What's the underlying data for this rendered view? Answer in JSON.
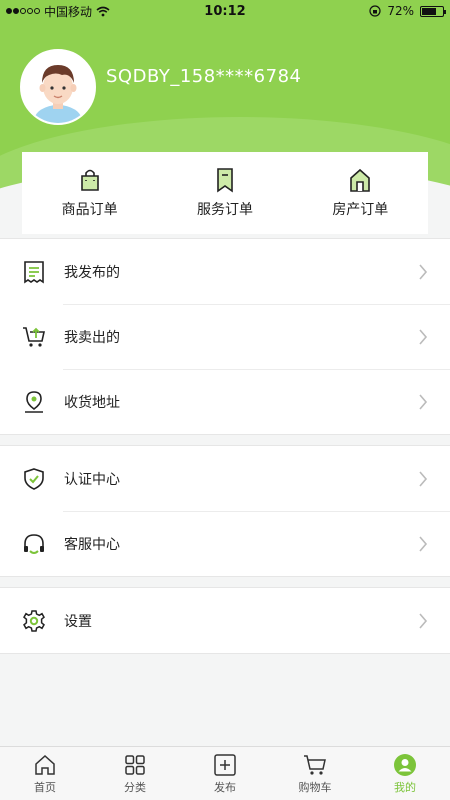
{
  "status": {
    "carrier": "中国移动",
    "time": "10:12",
    "battery": "72%"
  },
  "profile": {
    "username": "SQDBY_158****6784",
    "avatar": "avatar-boy"
  },
  "orders": [
    {
      "label": "商品订单",
      "icon": "shopping-bag-icon"
    },
    {
      "label": "服务订单",
      "icon": "bookmark-icon"
    },
    {
      "label": "房产订单",
      "icon": "house-icon"
    }
  ],
  "menu_group1": [
    {
      "label": "我发布的",
      "icon": "receipt-icon"
    },
    {
      "label": "我卖出的",
      "icon": "cart-upload-icon"
    },
    {
      "label": "收货地址",
      "icon": "location-pin-icon"
    }
  ],
  "menu_group2": [
    {
      "label": "认证中心",
      "icon": "shield-check-icon"
    },
    {
      "label": "客服中心",
      "icon": "headset-icon"
    }
  ],
  "menu_group3": [
    {
      "label": "设置",
      "icon": "gear-icon"
    }
  ],
  "tabs": [
    {
      "label": "首页",
      "icon": "home-icon"
    },
    {
      "label": "分类",
      "icon": "grid-icon"
    },
    {
      "label": "发布",
      "icon": "plus-square-icon"
    },
    {
      "label": "购物车",
      "icon": "cart-icon"
    },
    {
      "label": "我的",
      "icon": "user-icon",
      "active": true
    }
  ],
  "colors": {
    "brand": "#8fd14f",
    "accent": "#7cc43a"
  }
}
